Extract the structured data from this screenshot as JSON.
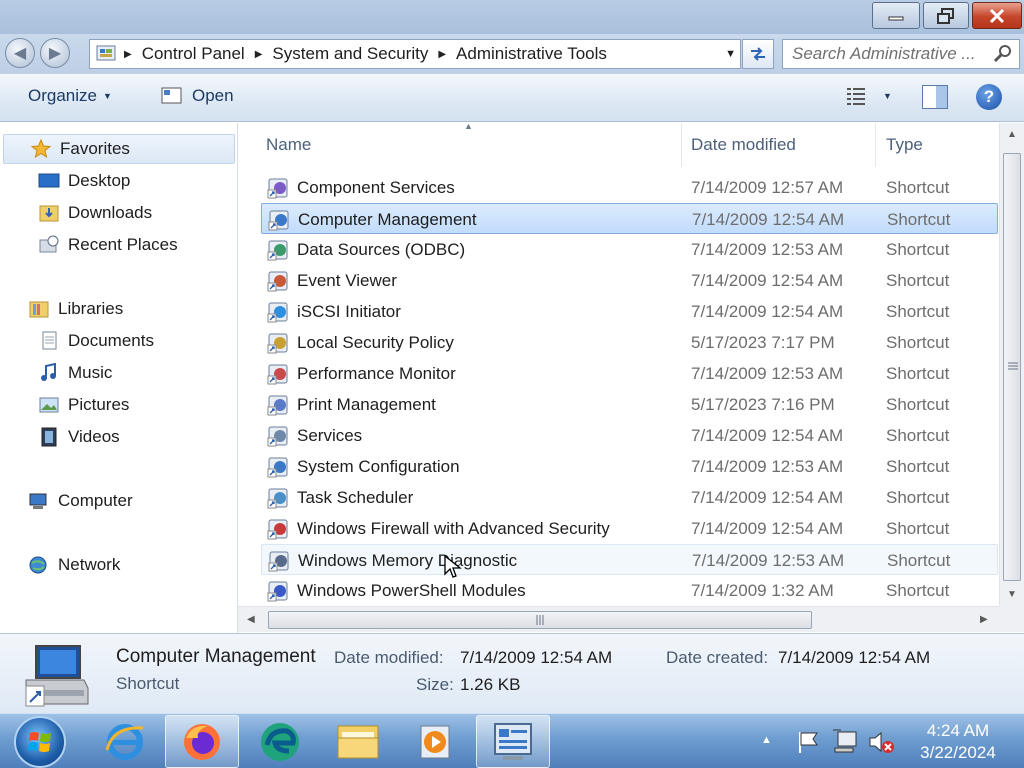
{
  "window": {
    "minimize_icon": "minimize-icon",
    "maximize_icon": "restore-icon",
    "close_icon": "close-icon"
  },
  "address": {
    "crumbs": [
      "Control Panel",
      "System and Security",
      "Administrative Tools"
    ],
    "search_placeholder": "Search Administrative ..."
  },
  "toolbar": {
    "organize_label": "Organize",
    "open_label": "Open"
  },
  "nav": {
    "favorites": "Favorites",
    "desktop": "Desktop",
    "downloads": "Downloads",
    "recent_places": "Recent Places",
    "libraries": "Libraries",
    "documents": "Documents",
    "music": "Music",
    "pictures": "Pictures",
    "videos": "Videos",
    "computer": "Computer",
    "network": "Network"
  },
  "columns": {
    "name": "Name",
    "date_modified": "Date modified",
    "type": "Type"
  },
  "files": [
    {
      "name": "Component Services",
      "date": "7/14/2009 12:57 AM",
      "type": "Shortcut"
    },
    {
      "name": "Computer Management",
      "date": "7/14/2009 12:54 AM",
      "type": "Shortcut"
    },
    {
      "name": "Data Sources (ODBC)",
      "date": "7/14/2009 12:53 AM",
      "type": "Shortcut"
    },
    {
      "name": "Event Viewer",
      "date": "7/14/2009 12:54 AM",
      "type": "Shortcut"
    },
    {
      "name": "iSCSI Initiator",
      "date": "7/14/2009 12:54 AM",
      "type": "Shortcut"
    },
    {
      "name": "Local Security Policy",
      "date": "5/17/2023 7:17 PM",
      "type": "Shortcut"
    },
    {
      "name": "Performance Monitor",
      "date": "7/14/2009 12:53 AM",
      "type": "Shortcut"
    },
    {
      "name": "Print Management",
      "date": "5/17/2023 7:16 PM",
      "type": "Shortcut"
    },
    {
      "name": "Services",
      "date": "7/14/2009 12:54 AM",
      "type": "Shortcut"
    },
    {
      "name": "System Configuration",
      "date": "7/14/2009 12:53 AM",
      "type": "Shortcut"
    },
    {
      "name": "Task Scheduler",
      "date": "7/14/2009 12:54 AM",
      "type": "Shortcut"
    },
    {
      "name": "Windows Firewall with Advanced Security",
      "date": "7/14/2009 12:54 AM",
      "type": "Shortcut"
    },
    {
      "name": "Windows Memory Diagnostic",
      "date": "7/14/2009 12:53 AM",
      "type": "Shortcut"
    },
    {
      "name": "Windows PowerShell Modules",
      "date": "7/14/2009 1:32 AM",
      "type": "Shortcut"
    }
  ],
  "selected_index": 1,
  "hover_index": 12,
  "details": {
    "name": "Computer Management",
    "type": "Shortcut",
    "date_modified_label": "Date modified:",
    "date_modified": "7/14/2009 12:54 AM",
    "date_created_label": "Date created:",
    "date_created": "7/14/2009 12:54 AM",
    "size_label": "Size:",
    "size": "1.26 KB"
  },
  "taskbar": {
    "apps": [
      "internet-explorer-icon",
      "firefox-icon",
      "edge-icon",
      "file-explorer-icon",
      "media-player-icon",
      "control-panel-icon"
    ],
    "active_app": "control-panel-icon"
  },
  "clock": {
    "time": "4:24 AM",
    "date": "3/22/2024"
  },
  "colors": {
    "selection": "#cce4fc",
    "title_bar": "#b8cce4",
    "taskbar": "#6e9dd0"
  }
}
